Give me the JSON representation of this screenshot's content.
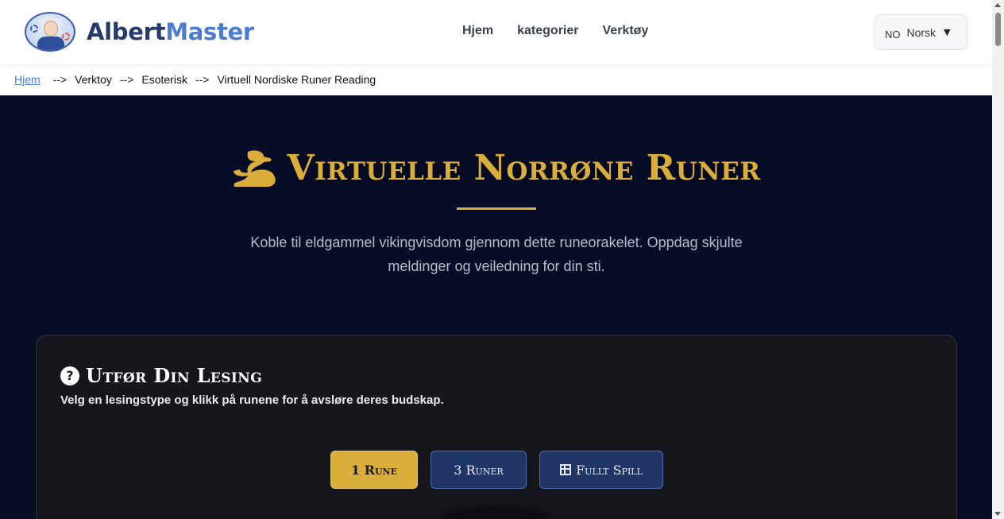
{
  "header": {
    "brand_part1": "Albert",
    "brand_part2": "Master",
    "nav": [
      "Hjem",
      "kategorier",
      "Verktøy"
    ],
    "language": {
      "code": "NO",
      "name": "Norsk",
      "caret": "▼"
    }
  },
  "breadcrumb": {
    "items": [
      "Hjem",
      "Verktoy",
      "Esoterisk",
      "Virtuell Nordiske Runer Reading"
    ],
    "separator": "-->"
  },
  "hero": {
    "title": "Virtuelle Norrøne Runer",
    "subtitle": "Koble til eldgammel vikingvisdom gjennom dette runeorakelet. Oppdag skjulte meldinger og veiledning for din sti."
  },
  "reading": {
    "icon_char": "?",
    "title": "Utfør Din Lesing",
    "description": "Velg en lesingstype og klikk på runene for å avsløre deres budskap.",
    "buttons": [
      "1 Rune",
      "3 Runer",
      "Fullt Spill"
    ],
    "active_button": "1 Rune"
  },
  "colors": {
    "gold": "#d9ae3b",
    "navy_bg": "#070d27",
    "card_bg": "#16171d",
    "button_blue": "#1f3566",
    "brand_dark": "#243a6a",
    "brand_light": "#4c7bd3"
  },
  "icons": [
    "logo-badge",
    "snake-icon",
    "question-circle-icon",
    "grid-icon",
    "caret-down-icon"
  ]
}
